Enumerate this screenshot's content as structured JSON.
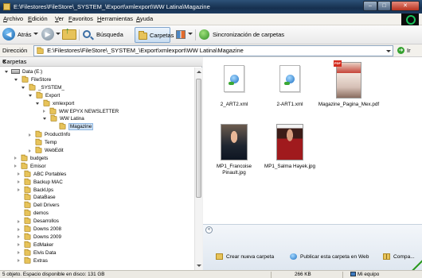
{
  "window": {
    "title": "E:\\Filestores\\FileStore\\_SYSTEM_\\Export\\xmlexport\\WW Latina\\Magazine",
    "controls": {
      "minimize": "–",
      "maximize": "□",
      "close": "✕"
    }
  },
  "menu": [
    "Archivo",
    "Edición",
    "Ver",
    "Favoritos",
    "Herramientas",
    "Ayuda"
  ],
  "toolbar": {
    "back_label": "Atrás",
    "search_label": "Búsqueda",
    "folders_label": "Carpetas",
    "sync_label": "Sincronización de carpetas"
  },
  "address": {
    "label": "Dirección",
    "path": "E:\\Filestores\\FileStore\\_SYSTEM_\\Export\\xmlexport\\WW Latina\\Magazine",
    "go_label": "Ir"
  },
  "folders_pane": {
    "title": "Carpetas",
    "close": "×",
    "tree": [
      {
        "label": "Data (E:)",
        "state": "open",
        "icon": "drive-icon",
        "selected": false
      },
      {
        "label": "FileStore",
        "state": "open",
        "icon": "folder-icon",
        "selected": false
      },
      {
        "label": "_SYSTEM_",
        "state": "open",
        "icon": "folder-icon",
        "selected": false
      },
      {
        "label": "Export",
        "state": "open",
        "icon": "folder-icon",
        "selected": false
      },
      {
        "label": "xmlexport",
        "state": "open",
        "icon": "folder-icon",
        "selected": false
      },
      {
        "label": "WW EPYX NEWSLETTER",
        "state": "closed",
        "icon": "folder-icon",
        "selected": false
      },
      {
        "label": "WW Latina",
        "state": "open",
        "icon": "folder-icon",
        "selected": false
      },
      {
        "label": "Magazine",
        "state": "none",
        "icon": "folder-icon",
        "selected": true
      },
      {
        "label": "ProductInfo",
        "state": "closed",
        "icon": "folder-icon",
        "selected": false
      },
      {
        "label": "Temp",
        "state": "none",
        "icon": "folder-icon",
        "selected": false
      },
      {
        "label": "WebEdit",
        "state": "closed",
        "icon": "folder-icon",
        "selected": false
      },
      {
        "label": "budgets",
        "state": "closed",
        "icon": "folder-icon",
        "selected": false
      },
      {
        "label": "Emisor",
        "state": "closed",
        "icon": "folder-icon",
        "selected": false
      },
      {
        "label": "ABC Portables",
        "state": "closed",
        "icon": "folder-icon",
        "selected": false
      },
      {
        "label": "Backup MAC",
        "state": "closed",
        "icon": "folder-icon",
        "selected": false
      },
      {
        "label": "BackUps",
        "state": "closed",
        "icon": "folder-icon",
        "selected": false
      },
      {
        "label": "DataBase",
        "state": "none",
        "icon": "folder-icon",
        "selected": false
      },
      {
        "label": "Dell Drivers",
        "state": "none",
        "icon": "folder-icon",
        "selected": false
      },
      {
        "label": "demos",
        "state": "none",
        "icon": "folder-icon",
        "selected": false
      },
      {
        "label": "Desarrollos",
        "state": "closed",
        "icon": "folder-icon",
        "selected": false
      },
      {
        "label": "Downs 2008",
        "state": "closed",
        "icon": "folder-icon",
        "selected": false
      },
      {
        "label": "Downs 2009",
        "state": "closed",
        "icon": "folder-icon",
        "selected": false
      },
      {
        "label": "EdMaker",
        "state": "closed",
        "icon": "folder-icon",
        "selected": false
      },
      {
        "label": "Elvis Data",
        "state": "closed",
        "icon": "folder-icon",
        "selected": false
      },
      {
        "label": "Extras",
        "state": "closed",
        "icon": "folder-icon",
        "selected": false
      }
    ]
  },
  "files": [
    {
      "name": "2_ART2.xml",
      "kind": "xml-file-icon"
    },
    {
      "name": "2-ART1.xml",
      "kind": "xml-file-icon"
    },
    {
      "name": "Magazine_Pagina_Mex.pdf",
      "kind": "pdf-thumbnail"
    },
    {
      "name": "MP1_Francoise Pinault.jpg",
      "kind": "photo-thumbnail"
    },
    {
      "name": "MP1_Salma Hayek.jpg",
      "kind": "photo-thumbnail"
    }
  ],
  "tasks": {
    "toggle": "«",
    "new_folder": "Crear nueva carpeta",
    "publish": "Publicar esta carpeta en Web",
    "compress": "Compa..."
  },
  "status": {
    "text": "5 objeto. Espacio disponible en disco: 131 GB",
    "size": "266 KB",
    "zone": "Mi equipo"
  },
  "colors": {
    "titlebar": "#1d3b60",
    "selection": "#cfe3f8",
    "folder": "#e7c35a"
  }
}
